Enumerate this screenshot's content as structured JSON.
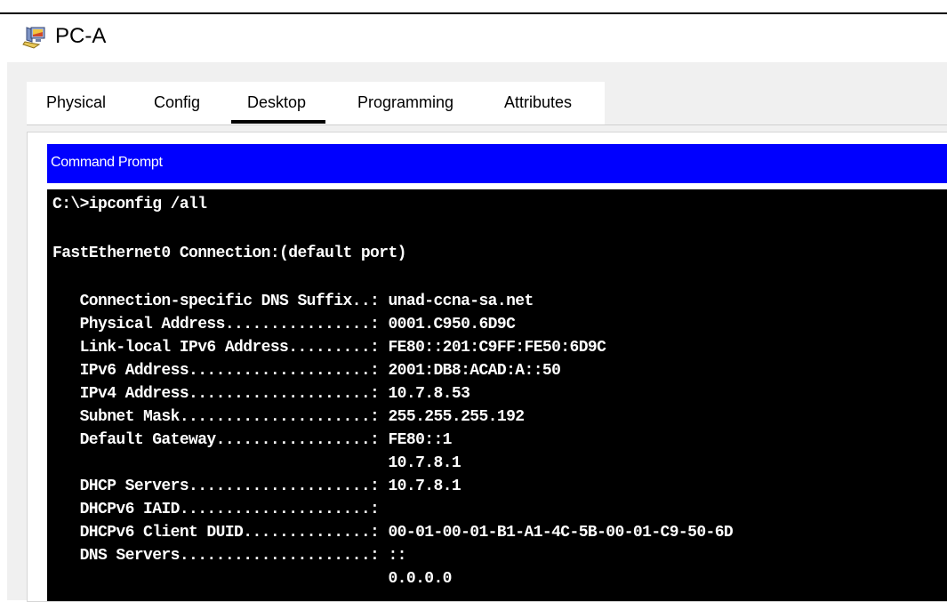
{
  "window": {
    "title": "PC-A",
    "icon": "pc-icon"
  },
  "tabs": [
    {
      "label": "Physical",
      "active": false
    },
    {
      "label": "Config",
      "active": false
    },
    {
      "label": "Desktop",
      "active": true
    },
    {
      "label": "Programming",
      "active": false
    },
    {
      "label": "Attributes",
      "active": false
    }
  ],
  "command_prompt": {
    "title": "Command Prompt",
    "header_color": "#0000ff",
    "lines": [
      "C:\\>ipconfig /all",
      "",
      "FastEthernet0 Connection:(default port)",
      "",
      "   Connection-specific DNS Suffix..: unad-ccna-sa.net",
      "   Physical Address................: 0001.C950.6D9C",
      "   Link-local IPv6 Address.........: FE80::201:C9FF:FE50:6D9C",
      "   IPv6 Address....................: 2001:DB8:ACAD:A::50",
      "   IPv4 Address....................: 10.7.8.53",
      "   Subnet Mask.....................: 255.255.255.192",
      "   Default Gateway.................: FE80::1",
      "                                     10.7.8.1",
      "   DHCP Servers....................: 10.7.8.1",
      "   DHCPv6 IAID.....................:",
      "   DHCPv6 Client DUID..............: 00-01-00-01-B1-A1-4C-5B-00-01-C9-50-6D",
      "   DNS Servers.....................: ::",
      "                                     0.0.0.0"
    ]
  }
}
